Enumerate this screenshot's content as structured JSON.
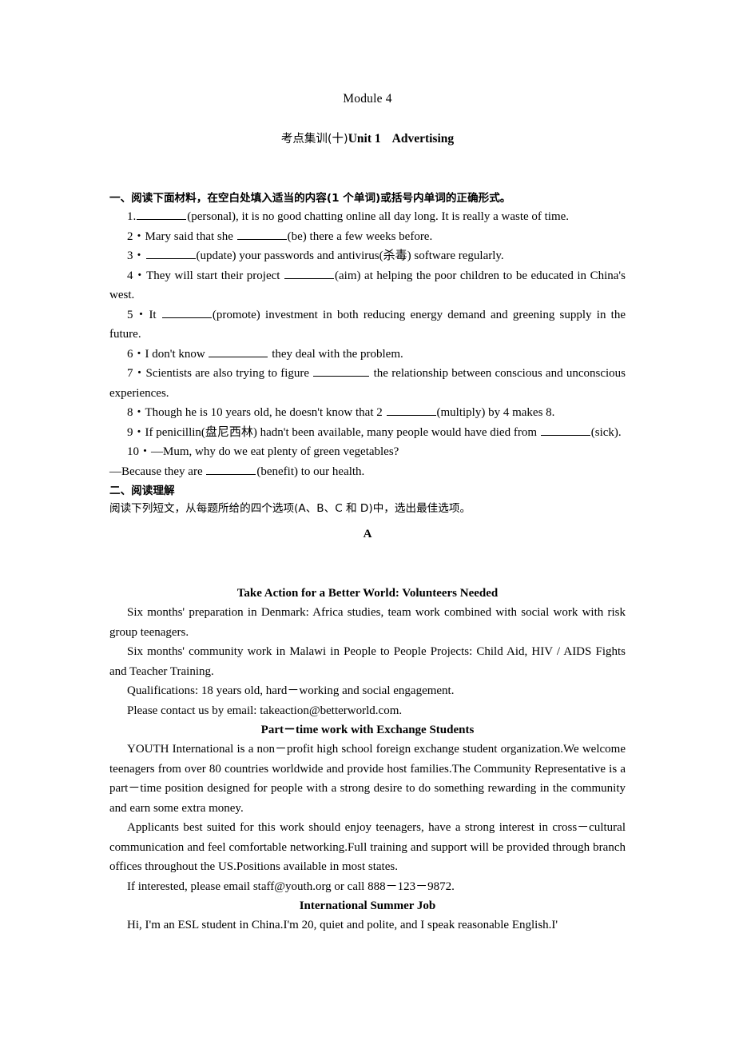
{
  "document": {
    "module_title": "Module 4",
    "exam_title": {
      "prefix_cn": "考点集训(十)",
      "unit": "Unit 1",
      "topic": "Advertising"
    }
  },
  "section_one": {
    "heading": "一、阅读下面材料，在空白处填入适当的内容(1 个单词)或括号内单词的正确形式。",
    "items": [
      {
        "number": "1.",
        "parts": [
          {
            "type": "blank"
          },
          {
            "type": "text",
            "value": "(personal), it is no good chatting online all day long. It is really a waste of time."
          }
        ]
      },
      {
        "number": "2・",
        "parts": [
          {
            "type": "text",
            "value": "Mary said that she "
          },
          {
            "type": "blank"
          },
          {
            "type": "text",
            "value": "(be) there a few weeks before."
          }
        ]
      },
      {
        "number": "3・",
        "parts": [
          {
            "type": "blank"
          },
          {
            "type": "text",
            "value": "(update) your passwords and antivirus(杀毒) software regularly."
          }
        ]
      },
      {
        "number": "4・",
        "parts": [
          {
            "type": "text",
            "value": "They will start their project "
          },
          {
            "type": "blank"
          },
          {
            "type": "text",
            "value": "(aim) at helping the poor children to be educated in China's west."
          }
        ]
      },
      {
        "number": "5・",
        "parts": [
          {
            "type": "text",
            "value": "It "
          },
          {
            "type": "blank"
          },
          {
            "type": "text",
            "value": "(promote) investment in both reducing energy demand and greening supply in the future."
          }
        ]
      },
      {
        "number": "6・",
        "parts": [
          {
            "type": "text",
            "value": "I don't know "
          },
          {
            "type": "blank"
          },
          {
            "type": "text",
            "value": " they deal with the problem."
          }
        ]
      },
      {
        "number": "7・",
        "parts": [
          {
            "type": "text",
            "value": "Scientists are also trying to figure "
          },
          {
            "type": "blank"
          },
          {
            "type": "text",
            "value": " the relationship between conscious and unconscious experiences."
          }
        ]
      },
      {
        "number": "8・",
        "parts": [
          {
            "type": "text",
            "value": "Though he is 10 years old, he doesn't know that 2 "
          },
          {
            "type": "blank"
          },
          {
            "type": "text",
            "value": "(multiply) by 4 makes 8."
          }
        ]
      },
      {
        "number": "9・",
        "parts": [
          {
            "type": "text",
            "value": "If penicillin(盘尼西林) hadn't been available, many people would have died from "
          },
          {
            "type": "blank"
          },
          {
            "type": "text",
            "value": "(sick)."
          }
        ]
      },
      {
        "number": "10・",
        "parts": [
          {
            "type": "text",
            "value": "—Mum, why do we eat plenty of green vegetables?"
          }
        ]
      }
    ],
    "item10_answer": {
      "lead": "—Because they are ",
      "tail": "(benefit) to our health."
    }
  },
  "section_two": {
    "heading": "二、阅读理解",
    "subheading": "阅读下列短文，从每题所给的四个选项(A、B、C 和 D)中，选出最佳选项。",
    "passage_letter": "A",
    "ads": [
      {
        "title": "Take Action for a Better World: Volunteers Needed",
        "paragraphs": [
          "Six months' preparation in Denmark: Africa studies, team work combined with social work with risk group teenagers.",
          "Six months'  community work in Malawi in People to People Projects: Child Aid, HIV / AIDS Fights and Teacher Training.",
          "Qualifications: 18 years old, hard－working and social engagement.",
          "Please contact us by email: takeaction@betterworld.com."
        ]
      },
      {
        "title": "Part－time work with Exchange Students",
        "paragraphs": [
          "YOUTH International is a non－profit high school foreign exchange student organization.We welcome teenagers from over 80 countries worldwide and provide host families.The Community Representative is a part－time position designed for people with a strong desire to do something rewarding in the community and earn some extra money.",
          "Applicants best suited for this work should enjoy teenagers, have a strong interest in cross－cultural communication and feel comfortable networking.Full training and support will be provided through branch offices throughout the US.Positions available in most states.",
          "If interested, please email staff@youth.org or call 888－123－9872."
        ]
      },
      {
        "title": "International Summer Job",
        "paragraphs": [
          "Hi, I'm an ESL student in China.I'm 20, quiet and polite, and I speak reasonable English.I'"
        ]
      }
    ]
  }
}
